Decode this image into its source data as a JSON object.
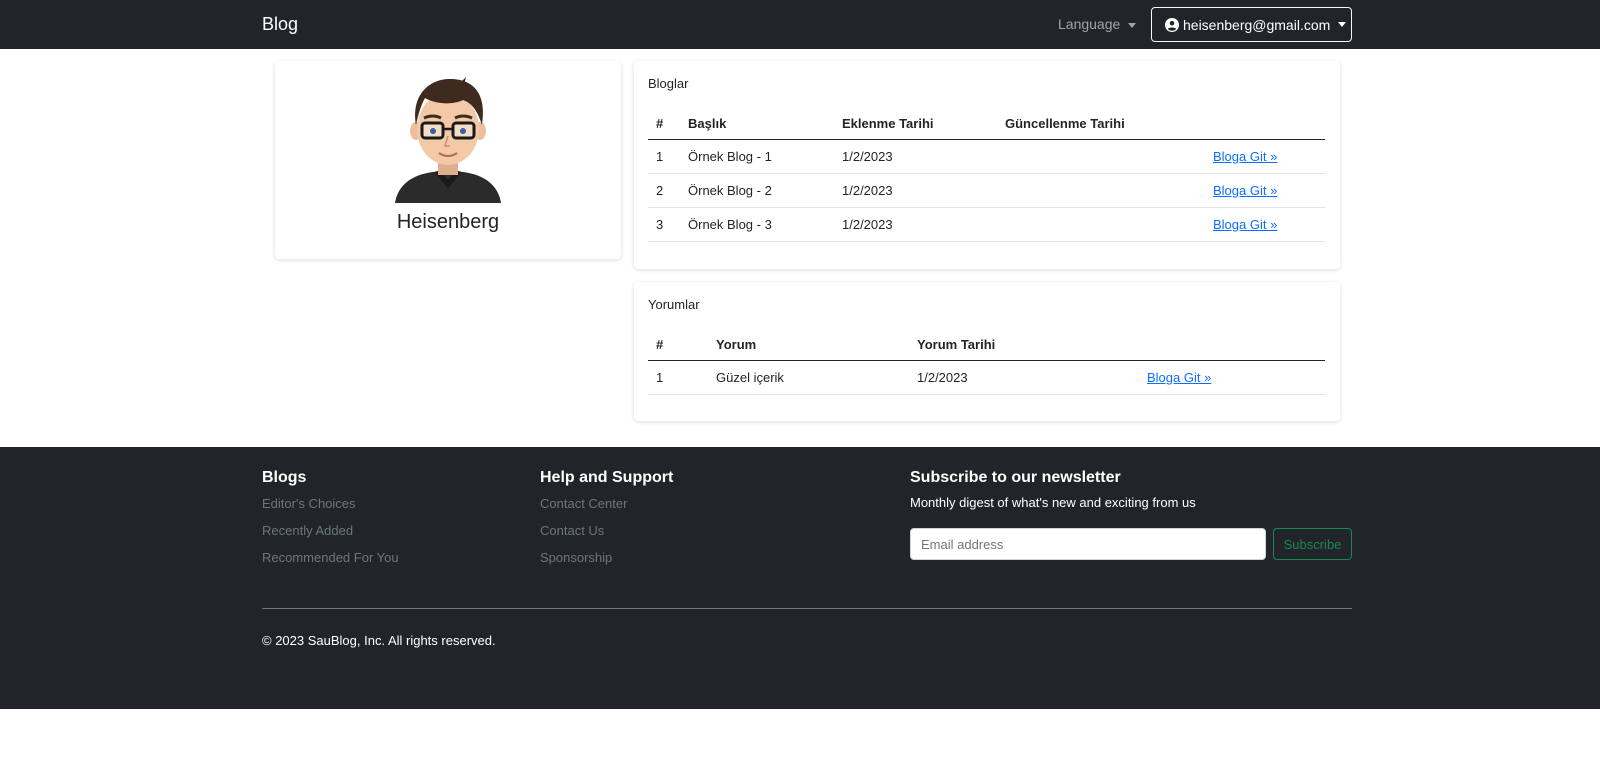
{
  "navbar": {
    "brand": "Blog",
    "language_label": "Language",
    "user_email": "heisenberg@gmail.com"
  },
  "profile": {
    "name": "Heisenberg"
  },
  "blogs": {
    "title": "Bloglar",
    "headers": [
      "#",
      "Başlık",
      "Eklenme Tarihi",
      "Güncellenme Tarihi",
      ""
    ],
    "rows": [
      {
        "num": "1",
        "title": "Örnek Blog - 1",
        "added": "1/2/2023",
        "updated": "",
        "link": "Bloga Git »"
      },
      {
        "num": "2",
        "title": "Örnek Blog - 2",
        "added": "1/2/2023",
        "updated": "",
        "link": "Bloga Git »"
      },
      {
        "num": "3",
        "title": "Örnek Blog - 3",
        "added": "1/2/2023",
        "updated": "",
        "link": "Bloga Git »"
      }
    ]
  },
  "comments": {
    "title": "Yorumlar",
    "headers": [
      "#",
      "Yorum",
      "Yorum Tarihi",
      ""
    ],
    "rows": [
      {
        "num": "1",
        "comment": "Güzel içerik",
        "date": "1/2/2023",
        "link": "Bloga Git »"
      }
    ]
  },
  "footer": {
    "blogs": {
      "heading": "Blogs",
      "links": [
        "Editor's Choices",
        "Recently Added",
        "Recommended For You"
      ]
    },
    "support": {
      "heading": "Help and Support",
      "links": [
        "Contact Center",
        "Contact Us",
        "Sponsorship"
      ]
    },
    "newsletter": {
      "heading": "Subscribe to our newsletter",
      "subtext": "Monthly digest of what's new and exciting from us",
      "email_placeholder": "Email address",
      "button": "Subscribe"
    },
    "copyright": "© 2023 SauBlog, Inc. All rights reserved."
  },
  "colors": {
    "navbar_bg": "#212529",
    "link_blue": "#0d6efd",
    "subscribe_green": "#198754"
  }
}
